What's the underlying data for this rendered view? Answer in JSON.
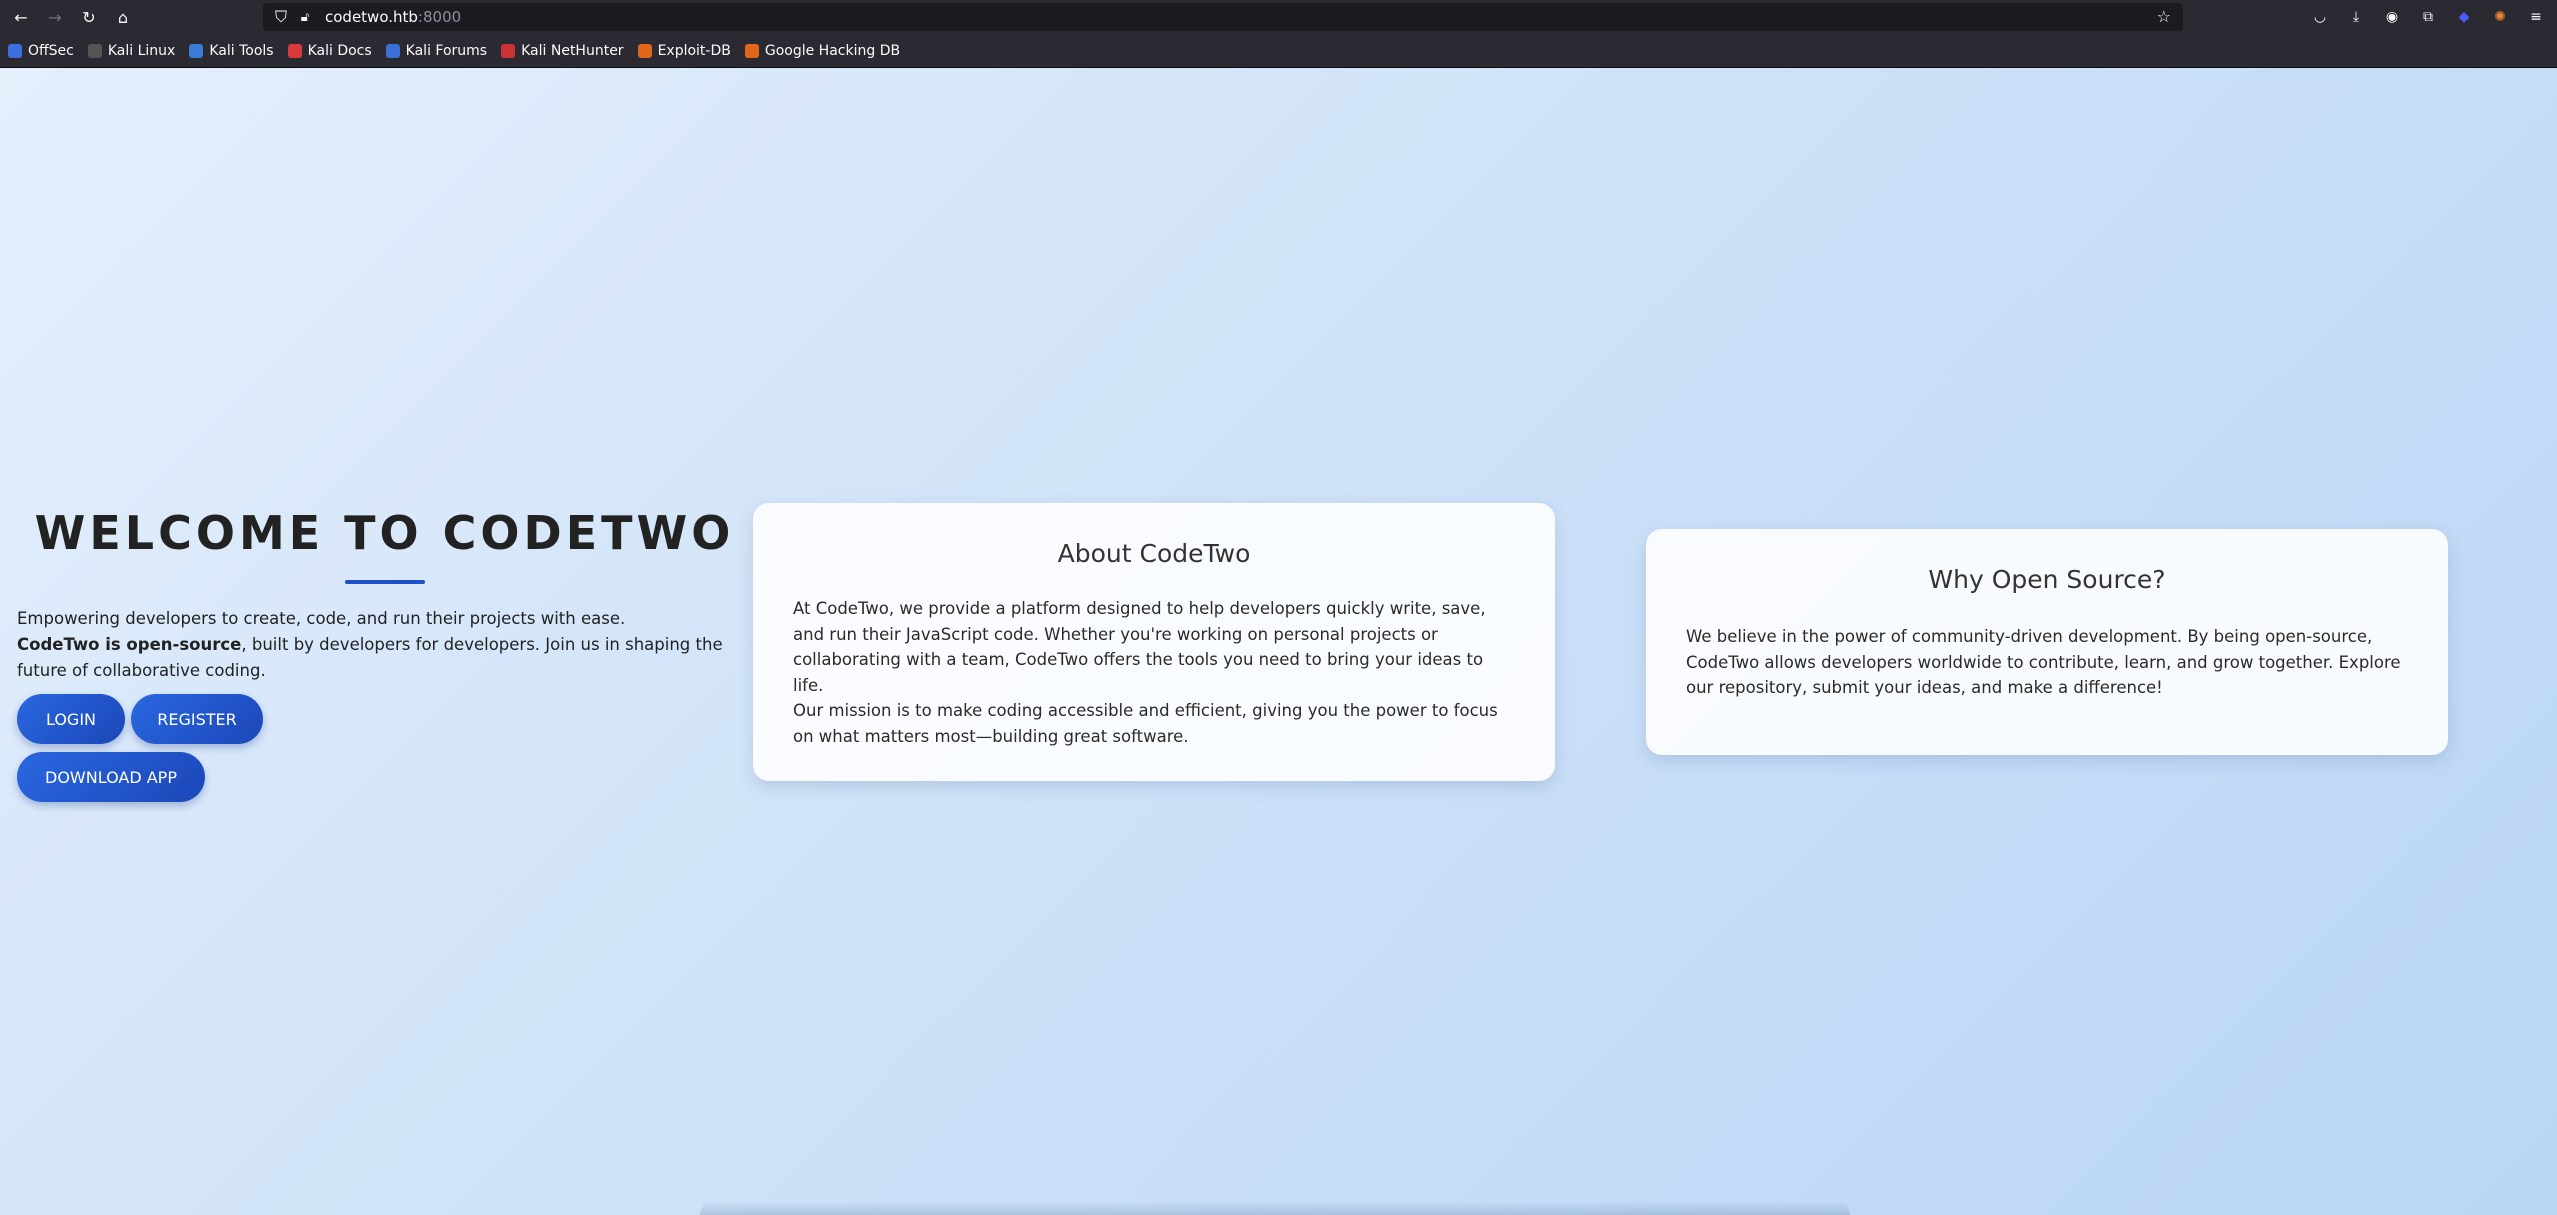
{
  "browser": {
    "url_host": "codetwo.htb",
    "url_port": ":8000",
    "bookmarks": [
      {
        "label": "OffSec",
        "color": "#3b6fe0"
      },
      {
        "label": "Kali Linux",
        "color": "#1a1a1a"
      },
      {
        "label": "Kali Tools",
        "color": "#3a7bd5"
      },
      {
        "label": "Kali Docs",
        "color": "#d63a3a"
      },
      {
        "label": "Kali Forums",
        "color": "#3a6fd8"
      },
      {
        "label": "Kali NetHunter",
        "color": "#c33"
      },
      {
        "label": "Exploit-DB",
        "color": "#e2661a"
      },
      {
        "label": "Google Hacking DB",
        "color": "#e2661a"
      }
    ]
  },
  "hero": {
    "title": "WELCOME TO CODETWO",
    "line1": "Empowering developers to create, code, and run their projects with ease.",
    "line2_bold": "CodeTwo is open-source",
    "line2_rest": ", built by developers for developers. Join us in shaping the future of collaborative coding.",
    "login_label": "LOGIN",
    "register_label": "REGISTER",
    "download_label": "DOWNLOAD APP"
  },
  "about": {
    "title": "About CodeTwo",
    "p1": "At CodeTwo, we provide a platform designed to help developers quickly write, save, and run their JavaScript code. Whether you're working on personal projects or collaborating with a team, CodeTwo offers the tools you need to bring your ideas to life.",
    "p2": "Our mission is to make coding accessible and efficient, giving you the power to focus on what matters most—building great software."
  },
  "open_source": {
    "title": "Why Open Source?",
    "body": "We believe in the power of community-driven development. By being open-source, CodeTwo allows developers worldwide to contribute, learn, and grow together. Explore our repository, submit your ideas, and make a difference!"
  },
  "colors": {
    "accent": "#1e50c8",
    "button": "#2a5ed6"
  }
}
